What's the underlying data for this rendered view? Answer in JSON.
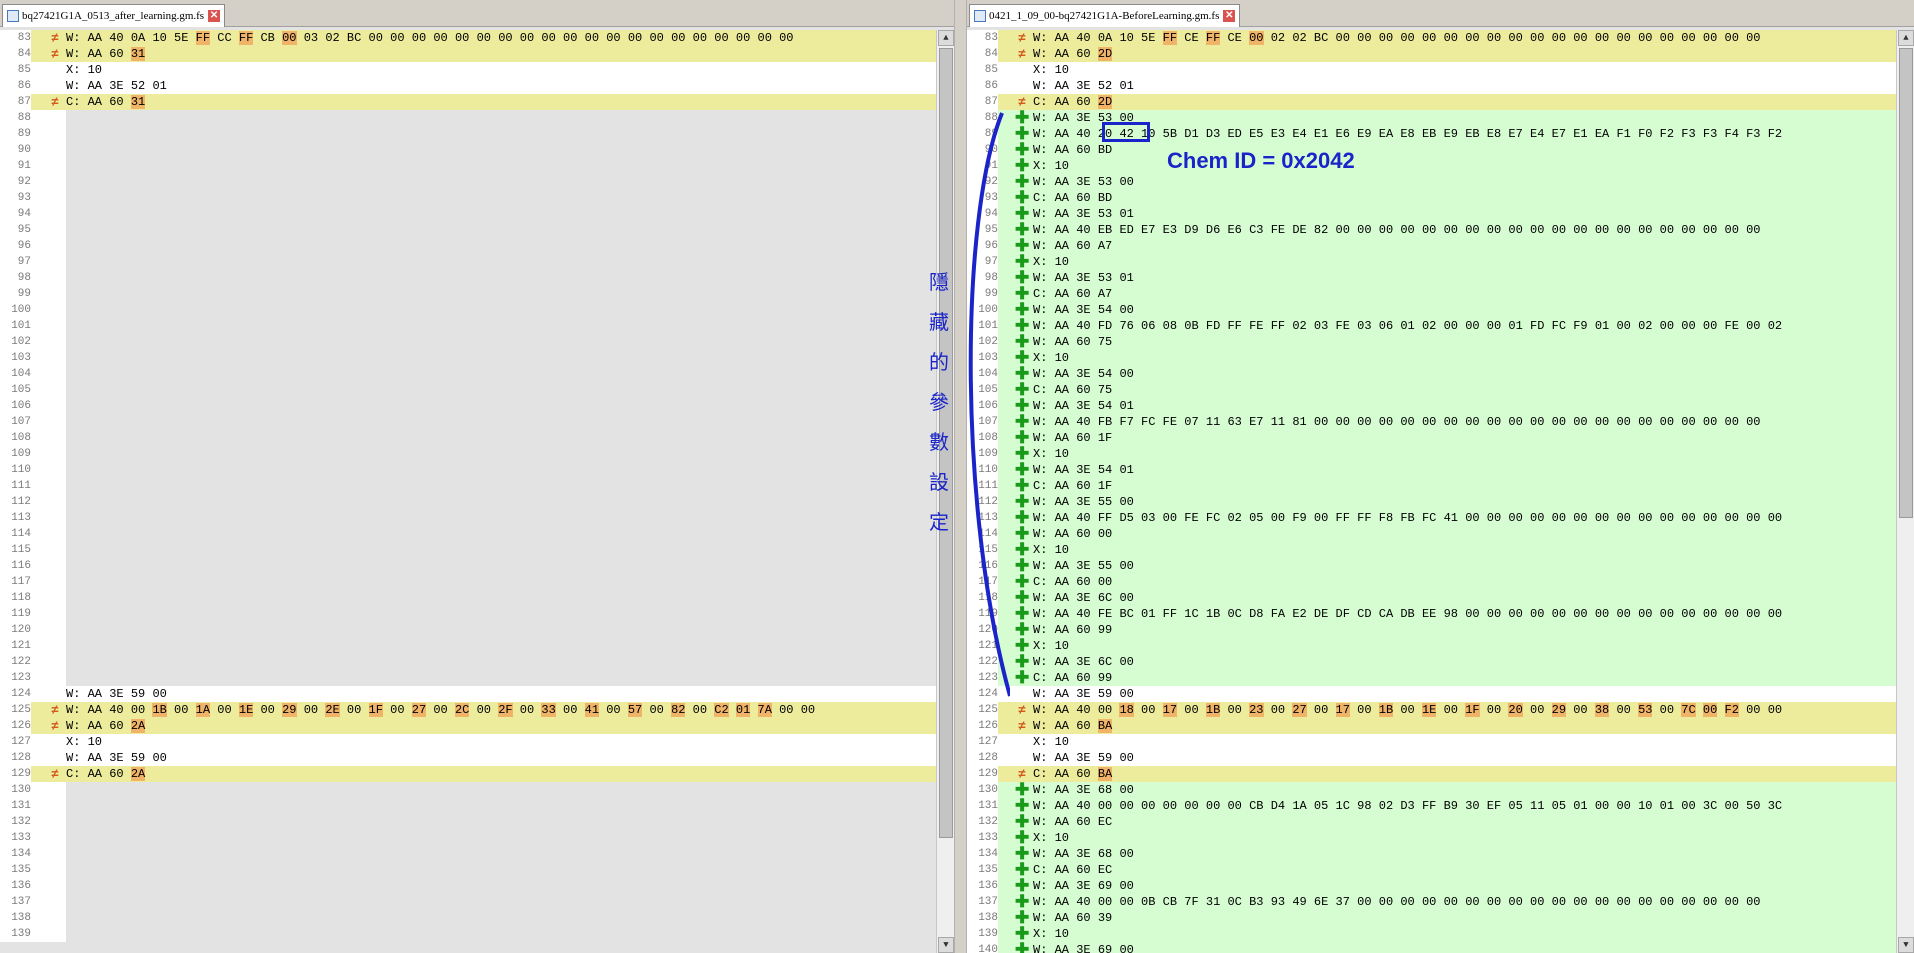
{
  "left": {
    "tab_label": "bq27421G1A_0513_after_learning.gm.fs",
    "lines": [
      {
        "n": "83",
        "m": "o",
        "c": "y",
        "t": "W: AA 40 0A 10 5E FF CC FF CB 00 03 02 BC 00 00 00 00 00 00 00 00 00 00 00 00 00 00 00 00 00 00 00 00",
        "h": [
          6,
          8,
          10
        ]
      },
      {
        "n": "84",
        "m": "o",
        "c": "y",
        "t": "W: AA 60 31",
        "h": [
          3
        ]
      },
      {
        "n": "85",
        "m": "",
        "c": "w",
        "t": "X: 10",
        "h": []
      },
      {
        "n": "86",
        "m": "",
        "c": "w",
        "t": "W: AA 3E 52 01",
        "h": []
      },
      {
        "n": "87",
        "m": "o",
        "c": "y",
        "t": "C: AA 60 31",
        "h": [
          3
        ]
      },
      {
        "n": "88",
        "m": "",
        "c": "g",
        "t": "",
        "h": []
      },
      {
        "n": "89",
        "m": "",
        "c": "g",
        "t": "",
        "h": []
      },
      {
        "n": "90",
        "m": "",
        "c": "g",
        "t": "",
        "h": []
      },
      {
        "n": "91",
        "m": "",
        "c": "g",
        "t": "",
        "h": []
      },
      {
        "n": "92",
        "m": "",
        "c": "g",
        "t": "",
        "h": []
      },
      {
        "n": "93",
        "m": "",
        "c": "g",
        "t": "",
        "h": []
      },
      {
        "n": "94",
        "m": "",
        "c": "g",
        "t": "",
        "h": []
      },
      {
        "n": "95",
        "m": "",
        "c": "g",
        "t": "",
        "h": []
      },
      {
        "n": "96",
        "m": "",
        "c": "g",
        "t": "",
        "h": []
      },
      {
        "n": "97",
        "m": "",
        "c": "g",
        "t": "",
        "h": []
      },
      {
        "n": "98",
        "m": "",
        "c": "g",
        "t": "",
        "h": []
      },
      {
        "n": "99",
        "m": "",
        "c": "g",
        "t": "",
        "h": []
      },
      {
        "n": "100",
        "m": "",
        "c": "g",
        "t": "",
        "h": []
      },
      {
        "n": "101",
        "m": "",
        "c": "g",
        "t": "",
        "h": []
      },
      {
        "n": "102",
        "m": "",
        "c": "g",
        "t": "",
        "h": []
      },
      {
        "n": "103",
        "m": "",
        "c": "g",
        "t": "",
        "h": []
      },
      {
        "n": "104",
        "m": "",
        "c": "g",
        "t": "",
        "h": []
      },
      {
        "n": "105",
        "m": "",
        "c": "g",
        "t": "",
        "h": []
      },
      {
        "n": "106",
        "m": "",
        "c": "g",
        "t": "",
        "h": []
      },
      {
        "n": "107",
        "m": "",
        "c": "g",
        "t": "",
        "h": []
      },
      {
        "n": "108",
        "m": "",
        "c": "g",
        "t": "",
        "h": []
      },
      {
        "n": "109",
        "m": "",
        "c": "g",
        "t": "",
        "h": []
      },
      {
        "n": "110",
        "m": "",
        "c": "g",
        "t": "",
        "h": []
      },
      {
        "n": "111",
        "m": "",
        "c": "g",
        "t": "",
        "h": []
      },
      {
        "n": "112",
        "m": "",
        "c": "g",
        "t": "",
        "h": []
      },
      {
        "n": "113",
        "m": "",
        "c": "g",
        "t": "",
        "h": []
      },
      {
        "n": "114",
        "m": "",
        "c": "g",
        "t": "",
        "h": []
      },
      {
        "n": "115",
        "m": "",
        "c": "g",
        "t": "",
        "h": []
      },
      {
        "n": "116",
        "m": "",
        "c": "g",
        "t": "",
        "h": []
      },
      {
        "n": "117",
        "m": "",
        "c": "g",
        "t": "",
        "h": []
      },
      {
        "n": "118",
        "m": "",
        "c": "g",
        "t": "",
        "h": []
      },
      {
        "n": "119",
        "m": "",
        "c": "g",
        "t": "",
        "h": []
      },
      {
        "n": "120",
        "m": "",
        "c": "g",
        "t": "",
        "h": []
      },
      {
        "n": "121",
        "m": "",
        "c": "g",
        "t": "",
        "h": []
      },
      {
        "n": "122",
        "m": "",
        "c": "g",
        "t": "",
        "h": []
      },
      {
        "n": "123",
        "m": "",
        "c": "g",
        "t": "",
        "h": []
      },
      {
        "n": "124",
        "m": "",
        "c": "w",
        "t": "W: AA 3E 59 00",
        "h": []
      },
      {
        "n": "125",
        "m": "o",
        "c": "y",
        "t": "W: AA 40 00 1B 00 1A 00 1E 00 29 00 2E 00 1F 00 27 00 2C 00 2F 00 33 00 41 00 57 00 82 00 C2 01 7A 00 00",
        "h": [
          4,
          6,
          8,
          10,
          12,
          14,
          16,
          18,
          20,
          22,
          24,
          26,
          28,
          30,
          31,
          32
        ]
      },
      {
        "n": "126",
        "m": "o",
        "c": "y",
        "t": "W: AA 60 2A",
        "h": [
          3
        ]
      },
      {
        "n": "127",
        "m": "",
        "c": "w",
        "t": "X: 10",
        "h": []
      },
      {
        "n": "128",
        "m": "",
        "c": "w",
        "t": "W: AA 3E 59 00",
        "h": []
      },
      {
        "n": "129",
        "m": "o",
        "c": "y",
        "t": "C: AA 60 2A",
        "h": [
          3
        ]
      },
      {
        "n": "130",
        "m": "",
        "c": "g",
        "t": "",
        "h": []
      },
      {
        "n": "131",
        "m": "",
        "c": "g",
        "t": "",
        "h": []
      },
      {
        "n": "132",
        "m": "",
        "c": "g",
        "t": "",
        "h": []
      },
      {
        "n": "133",
        "m": "",
        "c": "g",
        "t": "",
        "h": []
      },
      {
        "n": "134",
        "m": "",
        "c": "g",
        "t": "",
        "h": []
      },
      {
        "n": "135",
        "m": "",
        "c": "g",
        "t": "",
        "h": []
      },
      {
        "n": "136",
        "m": "",
        "c": "g",
        "t": "",
        "h": []
      },
      {
        "n": "137",
        "m": "",
        "c": "g",
        "t": "",
        "h": []
      },
      {
        "n": "138",
        "m": "",
        "c": "g",
        "t": "",
        "h": []
      },
      {
        "n": "139",
        "m": "",
        "c": "g",
        "t": "",
        "h": []
      }
    ]
  },
  "right": {
    "tab_label": "0421_1_09_00-bq27421G1A-BeforeLearning.gm.fs",
    "lines": [
      {
        "n": "83",
        "m": "o",
        "c": "y",
        "t": "W: AA 40 0A 10 5E FF CE FF CE 00 02 02 BC 00 00 00 00 00 00 00 00 00 00 00 00 00 00 00 00 00 00 00 00",
        "h": [
          6,
          8,
          10
        ]
      },
      {
        "n": "84",
        "m": "o",
        "c": "y",
        "t": "W: AA 60 2D",
        "h": [
          3
        ]
      },
      {
        "n": "85",
        "m": "",
        "c": "w",
        "t": "X: 10",
        "h": []
      },
      {
        "n": "86",
        "m": "",
        "c": "w",
        "t": "W: AA 3E 52 01",
        "h": []
      },
      {
        "n": "87",
        "m": "o",
        "c": "y",
        "t": "C: AA 60 2D",
        "h": [
          3
        ]
      },
      {
        "n": "88",
        "m": "g",
        "c": "n",
        "t": "W: AA 3E 53 00",
        "h": []
      },
      {
        "n": "89",
        "m": "g",
        "c": "n",
        "t": "W: AA 40 20 42 10 5B D1 D3 ED E5 E3 E4 E1 E6 E9 EA E8 EB E9 EB E8 E7 E4 E7 E1 EA F1 F0 F2 F3 F3 F4 F3 F2",
        "h": []
      },
      {
        "n": "90",
        "m": "g",
        "c": "n",
        "t": "W: AA 60 BD",
        "h": []
      },
      {
        "n": "91",
        "m": "g",
        "c": "n",
        "t": "X: 10",
        "h": []
      },
      {
        "n": "92",
        "m": "g",
        "c": "n",
        "t": "W: AA 3E 53 00",
        "h": []
      },
      {
        "n": "93",
        "m": "g",
        "c": "n",
        "t": "C: AA 60 BD",
        "h": []
      },
      {
        "n": "94",
        "m": "g",
        "c": "n",
        "t": "W: AA 3E 53 01",
        "h": []
      },
      {
        "n": "95",
        "m": "g",
        "c": "n",
        "t": "W: AA 40 EB ED E7 E3 D9 D6 E6 C3 FE DE 82 00 00 00 00 00 00 00 00 00 00 00 00 00 00 00 00 00 00 00 00",
        "h": []
      },
      {
        "n": "96",
        "m": "g",
        "c": "n",
        "t": "W: AA 60 A7",
        "h": []
      },
      {
        "n": "97",
        "m": "g",
        "c": "n",
        "t": "X: 10",
        "h": []
      },
      {
        "n": "98",
        "m": "g",
        "c": "n",
        "t": "W: AA 3E 53 01",
        "h": []
      },
      {
        "n": "99",
        "m": "g",
        "c": "n",
        "t": "C: AA 60 A7",
        "h": []
      },
      {
        "n": "100",
        "m": "g",
        "c": "n",
        "t": "W: AA 3E 54 00",
        "h": []
      },
      {
        "n": "101",
        "m": "g",
        "c": "n",
        "t": "W: AA 40 FD 76 06 08 0B FD FF FE FF 02 03 FE 03 06 01 02 00 00 00 01 FD FC F9 01 00 02 00 00 00 FE 00 02",
        "h": []
      },
      {
        "n": "102",
        "m": "g",
        "c": "n",
        "t": "W: AA 60 75",
        "h": []
      },
      {
        "n": "103",
        "m": "g",
        "c": "n",
        "t": "X: 10",
        "h": []
      },
      {
        "n": "104",
        "m": "g",
        "c": "n",
        "t": "W: AA 3E 54 00",
        "h": []
      },
      {
        "n": "105",
        "m": "g",
        "c": "n",
        "t": "C: AA 60 75",
        "h": []
      },
      {
        "n": "106",
        "m": "g",
        "c": "n",
        "t": "W: AA 3E 54 01",
        "h": []
      },
      {
        "n": "107",
        "m": "g",
        "c": "n",
        "t": "W: AA 40 FB F7 FC FE 07 11 63 E7 11 81 00 00 00 00 00 00 00 00 00 00 00 00 00 00 00 00 00 00 00 00 00",
        "h": []
      },
      {
        "n": "108",
        "m": "g",
        "c": "n",
        "t": "W: AA 60 1F",
        "h": []
      },
      {
        "n": "109",
        "m": "g",
        "c": "n",
        "t": "X: 10",
        "h": []
      },
      {
        "n": "110",
        "m": "g",
        "c": "n",
        "t": "W: AA 3E 54 01",
        "h": []
      },
      {
        "n": "111",
        "m": "g",
        "c": "n",
        "t": "C: AA 60 1F",
        "h": []
      },
      {
        "n": "112",
        "m": "g",
        "c": "n",
        "t": "W: AA 3E 55 00",
        "h": []
      },
      {
        "n": "113",
        "m": "g",
        "c": "n",
        "t": "W: AA 40 FF D5 03 00 FE FC 02 05 00 F9 00 FF FF F8 FB FC 41 00 00 00 00 00 00 00 00 00 00 00 00 00 00 00",
        "h": []
      },
      {
        "n": "114",
        "m": "g",
        "c": "n",
        "t": "W: AA 60 00",
        "h": []
      },
      {
        "n": "115",
        "m": "g",
        "c": "n",
        "t": "X: 10",
        "h": []
      },
      {
        "n": "116",
        "m": "g",
        "c": "n",
        "t": "W: AA 3E 55 00",
        "h": []
      },
      {
        "n": "117",
        "m": "g",
        "c": "n",
        "t": "C: AA 60 00",
        "h": []
      },
      {
        "n": "118",
        "m": "g",
        "c": "n",
        "t": "W: AA 3E 6C 00",
        "h": []
      },
      {
        "n": "119",
        "m": "g",
        "c": "n",
        "t": "W: AA 40 FE BC 01 FF 1C 1B 0C D8 FA E2 DE DF CD CA DB EE 98 00 00 00 00 00 00 00 00 00 00 00 00 00 00 00",
        "h": []
      },
      {
        "n": "120",
        "m": "g",
        "c": "n",
        "t": "W: AA 60 99",
        "h": []
      },
      {
        "n": "121",
        "m": "g",
        "c": "n",
        "t": "X: 10",
        "h": []
      },
      {
        "n": "122",
        "m": "g",
        "c": "n",
        "t": "W: AA 3E 6C 00",
        "h": []
      },
      {
        "n": "123",
        "m": "g",
        "c": "n",
        "t": "C: AA 60 99",
        "h": []
      },
      {
        "n": "124",
        "m": "",
        "c": "w",
        "t": "W: AA 3E 59 00",
        "h": []
      },
      {
        "n": "125",
        "m": "o",
        "c": "y",
        "t": "W: AA 40 00 18 00 17 00 1B 00 23 00 27 00 17 00 1B 00 1E 00 1F 00 20 00 29 00 38 00 53 00 7C 00 F2 00 00",
        "h": [
          4,
          6,
          8,
          10,
          12,
          14,
          16,
          18,
          20,
          22,
          24,
          26,
          28,
          30,
          31,
          32
        ]
      },
      {
        "n": "126",
        "m": "o",
        "c": "y",
        "t": "W: AA 60 BA",
        "h": [
          3
        ]
      },
      {
        "n": "127",
        "m": "",
        "c": "w",
        "t": "X: 10",
        "h": []
      },
      {
        "n": "128",
        "m": "",
        "c": "w",
        "t": "W: AA 3E 59 00",
        "h": []
      },
      {
        "n": "129",
        "m": "o",
        "c": "y",
        "t": "C: AA 60 BA",
        "h": [
          3
        ]
      },
      {
        "n": "130",
        "m": "g",
        "c": "n",
        "t": "W: AA 3E 68 00",
        "h": []
      },
      {
        "n": "131",
        "m": "g",
        "c": "n",
        "t": "W: AA 40 00 00 00 00 00 00 00 CB D4 1A 05 1C 98 02 D3 FF B9 30 EF 05 11 05 01 00 00 10 01 00 3C 00 50 3C",
        "h": []
      },
      {
        "n": "132",
        "m": "g",
        "c": "n",
        "t": "W: AA 60 EC",
        "h": []
      },
      {
        "n": "133",
        "m": "g",
        "c": "n",
        "t": "X: 10",
        "h": []
      },
      {
        "n": "134",
        "m": "g",
        "c": "n",
        "t": "W: AA 3E 68 00",
        "h": []
      },
      {
        "n": "135",
        "m": "g",
        "c": "n",
        "t": "C: AA 60 EC",
        "h": []
      },
      {
        "n": "136",
        "m": "g",
        "c": "n",
        "t": "W: AA 3E 69 00",
        "h": []
      },
      {
        "n": "137",
        "m": "g",
        "c": "n",
        "t": "W: AA 40 00 00 0B CB 7F 31 0C B3 93 49 6E 37 00 00 00 00 00 00 00 00 00 00 00 00 00 00 00 00 00 00 00",
        "h": []
      },
      {
        "n": "138",
        "m": "g",
        "c": "n",
        "t": "W: AA 60 39",
        "h": []
      },
      {
        "n": "139",
        "m": "g",
        "c": "n",
        "t": "X: 10",
        "h": []
      },
      {
        "n": "140",
        "m": "g",
        "c": "n",
        "t": "W: AA 3E 69 00",
        "h": []
      }
    ]
  },
  "annotation": {
    "hidden_params_text": "隱藏的參數設定",
    "chem_id_text": "Chem ID = 0x2042",
    "color": "#1a24c8"
  },
  "colors": {
    "changed_row": "#ecec9c",
    "inserted_row": "#d6fcd2",
    "diff_byte": "#f0b469",
    "gap": "#e3e3e3"
  }
}
